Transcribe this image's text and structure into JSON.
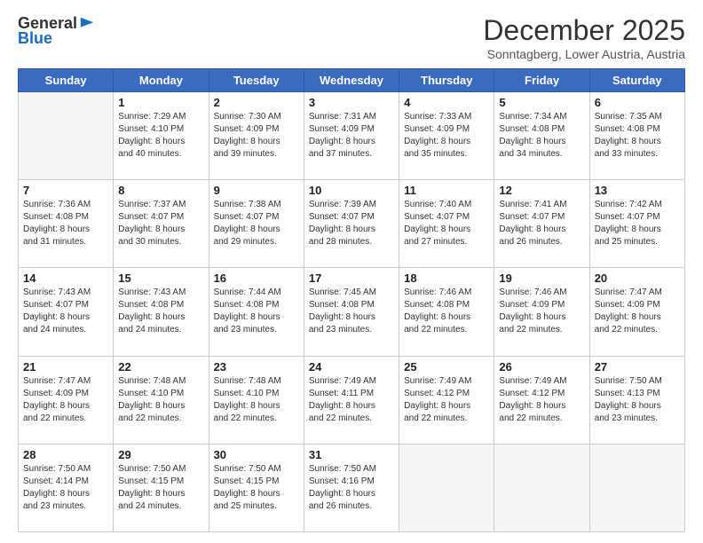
{
  "logo": {
    "general": "General",
    "blue": "Blue"
  },
  "header": {
    "month": "December 2025",
    "location": "Sonntagberg, Lower Austria, Austria"
  },
  "weekdays": [
    "Sunday",
    "Monday",
    "Tuesday",
    "Wednesday",
    "Thursday",
    "Friday",
    "Saturday"
  ],
  "weeks": [
    [
      {
        "day": "",
        "lines": []
      },
      {
        "day": "1",
        "lines": [
          "Sunrise: 7:29 AM",
          "Sunset: 4:10 PM",
          "Daylight: 8 hours",
          "and 40 minutes."
        ]
      },
      {
        "day": "2",
        "lines": [
          "Sunrise: 7:30 AM",
          "Sunset: 4:09 PM",
          "Daylight: 8 hours",
          "and 39 minutes."
        ]
      },
      {
        "day": "3",
        "lines": [
          "Sunrise: 7:31 AM",
          "Sunset: 4:09 PM",
          "Daylight: 8 hours",
          "and 37 minutes."
        ]
      },
      {
        "day": "4",
        "lines": [
          "Sunrise: 7:33 AM",
          "Sunset: 4:09 PM",
          "Daylight: 8 hours",
          "and 35 minutes."
        ]
      },
      {
        "day": "5",
        "lines": [
          "Sunrise: 7:34 AM",
          "Sunset: 4:08 PM",
          "Daylight: 8 hours",
          "and 34 minutes."
        ]
      },
      {
        "day": "6",
        "lines": [
          "Sunrise: 7:35 AM",
          "Sunset: 4:08 PM",
          "Daylight: 8 hours",
          "and 33 minutes."
        ]
      }
    ],
    [
      {
        "day": "7",
        "lines": [
          "Sunrise: 7:36 AM",
          "Sunset: 4:08 PM",
          "Daylight: 8 hours",
          "and 31 minutes."
        ]
      },
      {
        "day": "8",
        "lines": [
          "Sunrise: 7:37 AM",
          "Sunset: 4:07 PM",
          "Daylight: 8 hours",
          "and 30 minutes."
        ]
      },
      {
        "day": "9",
        "lines": [
          "Sunrise: 7:38 AM",
          "Sunset: 4:07 PM",
          "Daylight: 8 hours",
          "and 29 minutes."
        ]
      },
      {
        "day": "10",
        "lines": [
          "Sunrise: 7:39 AM",
          "Sunset: 4:07 PM",
          "Daylight: 8 hours",
          "and 28 minutes."
        ]
      },
      {
        "day": "11",
        "lines": [
          "Sunrise: 7:40 AM",
          "Sunset: 4:07 PM",
          "Daylight: 8 hours",
          "and 27 minutes."
        ]
      },
      {
        "day": "12",
        "lines": [
          "Sunrise: 7:41 AM",
          "Sunset: 4:07 PM",
          "Daylight: 8 hours",
          "and 26 minutes."
        ]
      },
      {
        "day": "13",
        "lines": [
          "Sunrise: 7:42 AM",
          "Sunset: 4:07 PM",
          "Daylight: 8 hours",
          "and 25 minutes."
        ]
      }
    ],
    [
      {
        "day": "14",
        "lines": [
          "Sunrise: 7:43 AM",
          "Sunset: 4:07 PM",
          "Daylight: 8 hours",
          "and 24 minutes."
        ]
      },
      {
        "day": "15",
        "lines": [
          "Sunrise: 7:43 AM",
          "Sunset: 4:08 PM",
          "Daylight: 8 hours",
          "and 24 minutes."
        ]
      },
      {
        "day": "16",
        "lines": [
          "Sunrise: 7:44 AM",
          "Sunset: 4:08 PM",
          "Daylight: 8 hours",
          "and 23 minutes."
        ]
      },
      {
        "day": "17",
        "lines": [
          "Sunrise: 7:45 AM",
          "Sunset: 4:08 PM",
          "Daylight: 8 hours",
          "and 23 minutes."
        ]
      },
      {
        "day": "18",
        "lines": [
          "Sunrise: 7:46 AM",
          "Sunset: 4:08 PM",
          "Daylight: 8 hours",
          "and 22 minutes."
        ]
      },
      {
        "day": "19",
        "lines": [
          "Sunrise: 7:46 AM",
          "Sunset: 4:09 PM",
          "Daylight: 8 hours",
          "and 22 minutes."
        ]
      },
      {
        "day": "20",
        "lines": [
          "Sunrise: 7:47 AM",
          "Sunset: 4:09 PM",
          "Daylight: 8 hours",
          "and 22 minutes."
        ]
      }
    ],
    [
      {
        "day": "21",
        "lines": [
          "Sunrise: 7:47 AM",
          "Sunset: 4:09 PM",
          "Daylight: 8 hours",
          "and 22 minutes."
        ]
      },
      {
        "day": "22",
        "lines": [
          "Sunrise: 7:48 AM",
          "Sunset: 4:10 PM",
          "Daylight: 8 hours",
          "and 22 minutes."
        ]
      },
      {
        "day": "23",
        "lines": [
          "Sunrise: 7:48 AM",
          "Sunset: 4:10 PM",
          "Daylight: 8 hours",
          "and 22 minutes."
        ]
      },
      {
        "day": "24",
        "lines": [
          "Sunrise: 7:49 AM",
          "Sunset: 4:11 PM",
          "Daylight: 8 hours",
          "and 22 minutes."
        ]
      },
      {
        "day": "25",
        "lines": [
          "Sunrise: 7:49 AM",
          "Sunset: 4:12 PM",
          "Daylight: 8 hours",
          "and 22 minutes."
        ]
      },
      {
        "day": "26",
        "lines": [
          "Sunrise: 7:49 AM",
          "Sunset: 4:12 PM",
          "Daylight: 8 hours",
          "and 22 minutes."
        ]
      },
      {
        "day": "27",
        "lines": [
          "Sunrise: 7:50 AM",
          "Sunset: 4:13 PM",
          "Daylight: 8 hours",
          "and 23 minutes."
        ]
      }
    ],
    [
      {
        "day": "28",
        "lines": [
          "Sunrise: 7:50 AM",
          "Sunset: 4:14 PM",
          "Daylight: 8 hours",
          "and 23 minutes."
        ]
      },
      {
        "day": "29",
        "lines": [
          "Sunrise: 7:50 AM",
          "Sunset: 4:15 PM",
          "Daylight: 8 hours",
          "and 24 minutes."
        ]
      },
      {
        "day": "30",
        "lines": [
          "Sunrise: 7:50 AM",
          "Sunset: 4:15 PM",
          "Daylight: 8 hours",
          "and 25 minutes."
        ]
      },
      {
        "day": "31",
        "lines": [
          "Sunrise: 7:50 AM",
          "Sunset: 4:16 PM",
          "Daylight: 8 hours",
          "and 26 minutes."
        ]
      },
      {
        "day": "",
        "lines": []
      },
      {
        "day": "",
        "lines": []
      },
      {
        "day": "",
        "lines": []
      }
    ]
  ]
}
